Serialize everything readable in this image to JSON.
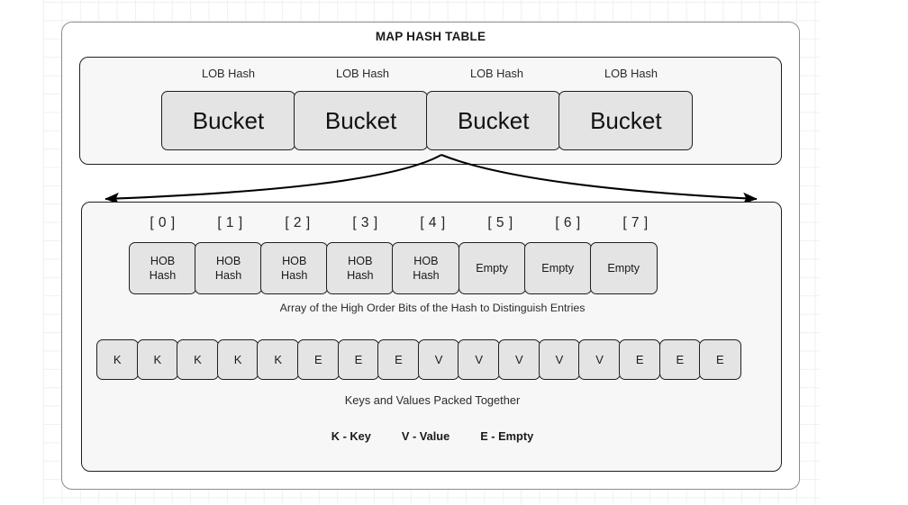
{
  "diagram": {
    "title": "MAP HASH TABLE",
    "colors": {
      "page_background": "#ffffff",
      "grid_line": "#f0f0f0",
      "outer_border": "#8c8c8c",
      "panel_fill": "#f7f7f7",
      "panel_border": "#1f1f1f",
      "cell_fill": "#e4e4e4",
      "cell_border": "#1f1f1f",
      "text": "#1a1a1a",
      "connector": "#000000"
    }
  },
  "bucket_panel": {
    "name": "map-hash-table-bucket-row",
    "bucket_labels": [
      "LOB Hash",
      "LOB Hash",
      "LOB Hash",
      "LOB Hash"
    ],
    "buckets": [
      "Bucket",
      "Bucket",
      "Bucket",
      "Bucket"
    ],
    "bucket_count": 4
  },
  "connector": {
    "name": "bucket-to-entry-fanout",
    "arrow_count": 2,
    "source_bucket_index": 2,
    "description": "Two curved arrows from the third bucket fanning out to the entry panel"
  },
  "entry_panel": {
    "name": "bucket-entry-detail",
    "index_labels": [
      "[ 0 ]",
      "[ 1 ]",
      "[ 2 ]",
      "[ 3 ]",
      "[ 4 ]",
      "[ 5 ]",
      "[ 6 ]",
      "[ 7 ]"
    ],
    "hob_cells": [
      {
        "line1": "HOB",
        "line2": "Hash",
        "state": "occupied"
      },
      {
        "line1": "HOB",
        "line2": "Hash",
        "state": "occupied"
      },
      {
        "line1": "HOB",
        "line2": "Hash",
        "state": "occupied"
      },
      {
        "line1": "HOB",
        "line2": "Hash",
        "state": "occupied"
      },
      {
        "line1": "HOB",
        "line2": "Hash",
        "state": "occupied"
      },
      {
        "line1": "Empty",
        "line2": "",
        "state": "empty"
      },
      {
        "line1": "Empty",
        "line2": "",
        "state": "empty"
      },
      {
        "line1": "Empty",
        "line2": "",
        "state": "empty"
      }
    ],
    "hob_caption": "Array of the High Order Bits of the Hash to Distinguish Entries",
    "kv_cells": [
      "K",
      "K",
      "K",
      "K",
      "K",
      "E",
      "E",
      "E",
      "V",
      "V",
      "V",
      "V",
      "V",
      "E",
      "E",
      "E"
    ],
    "kv_cell_count": 16,
    "kv_caption": "Keys and Values Packed Together",
    "legend": [
      "K - Key",
      "V - Value",
      "E - Empty"
    ]
  }
}
